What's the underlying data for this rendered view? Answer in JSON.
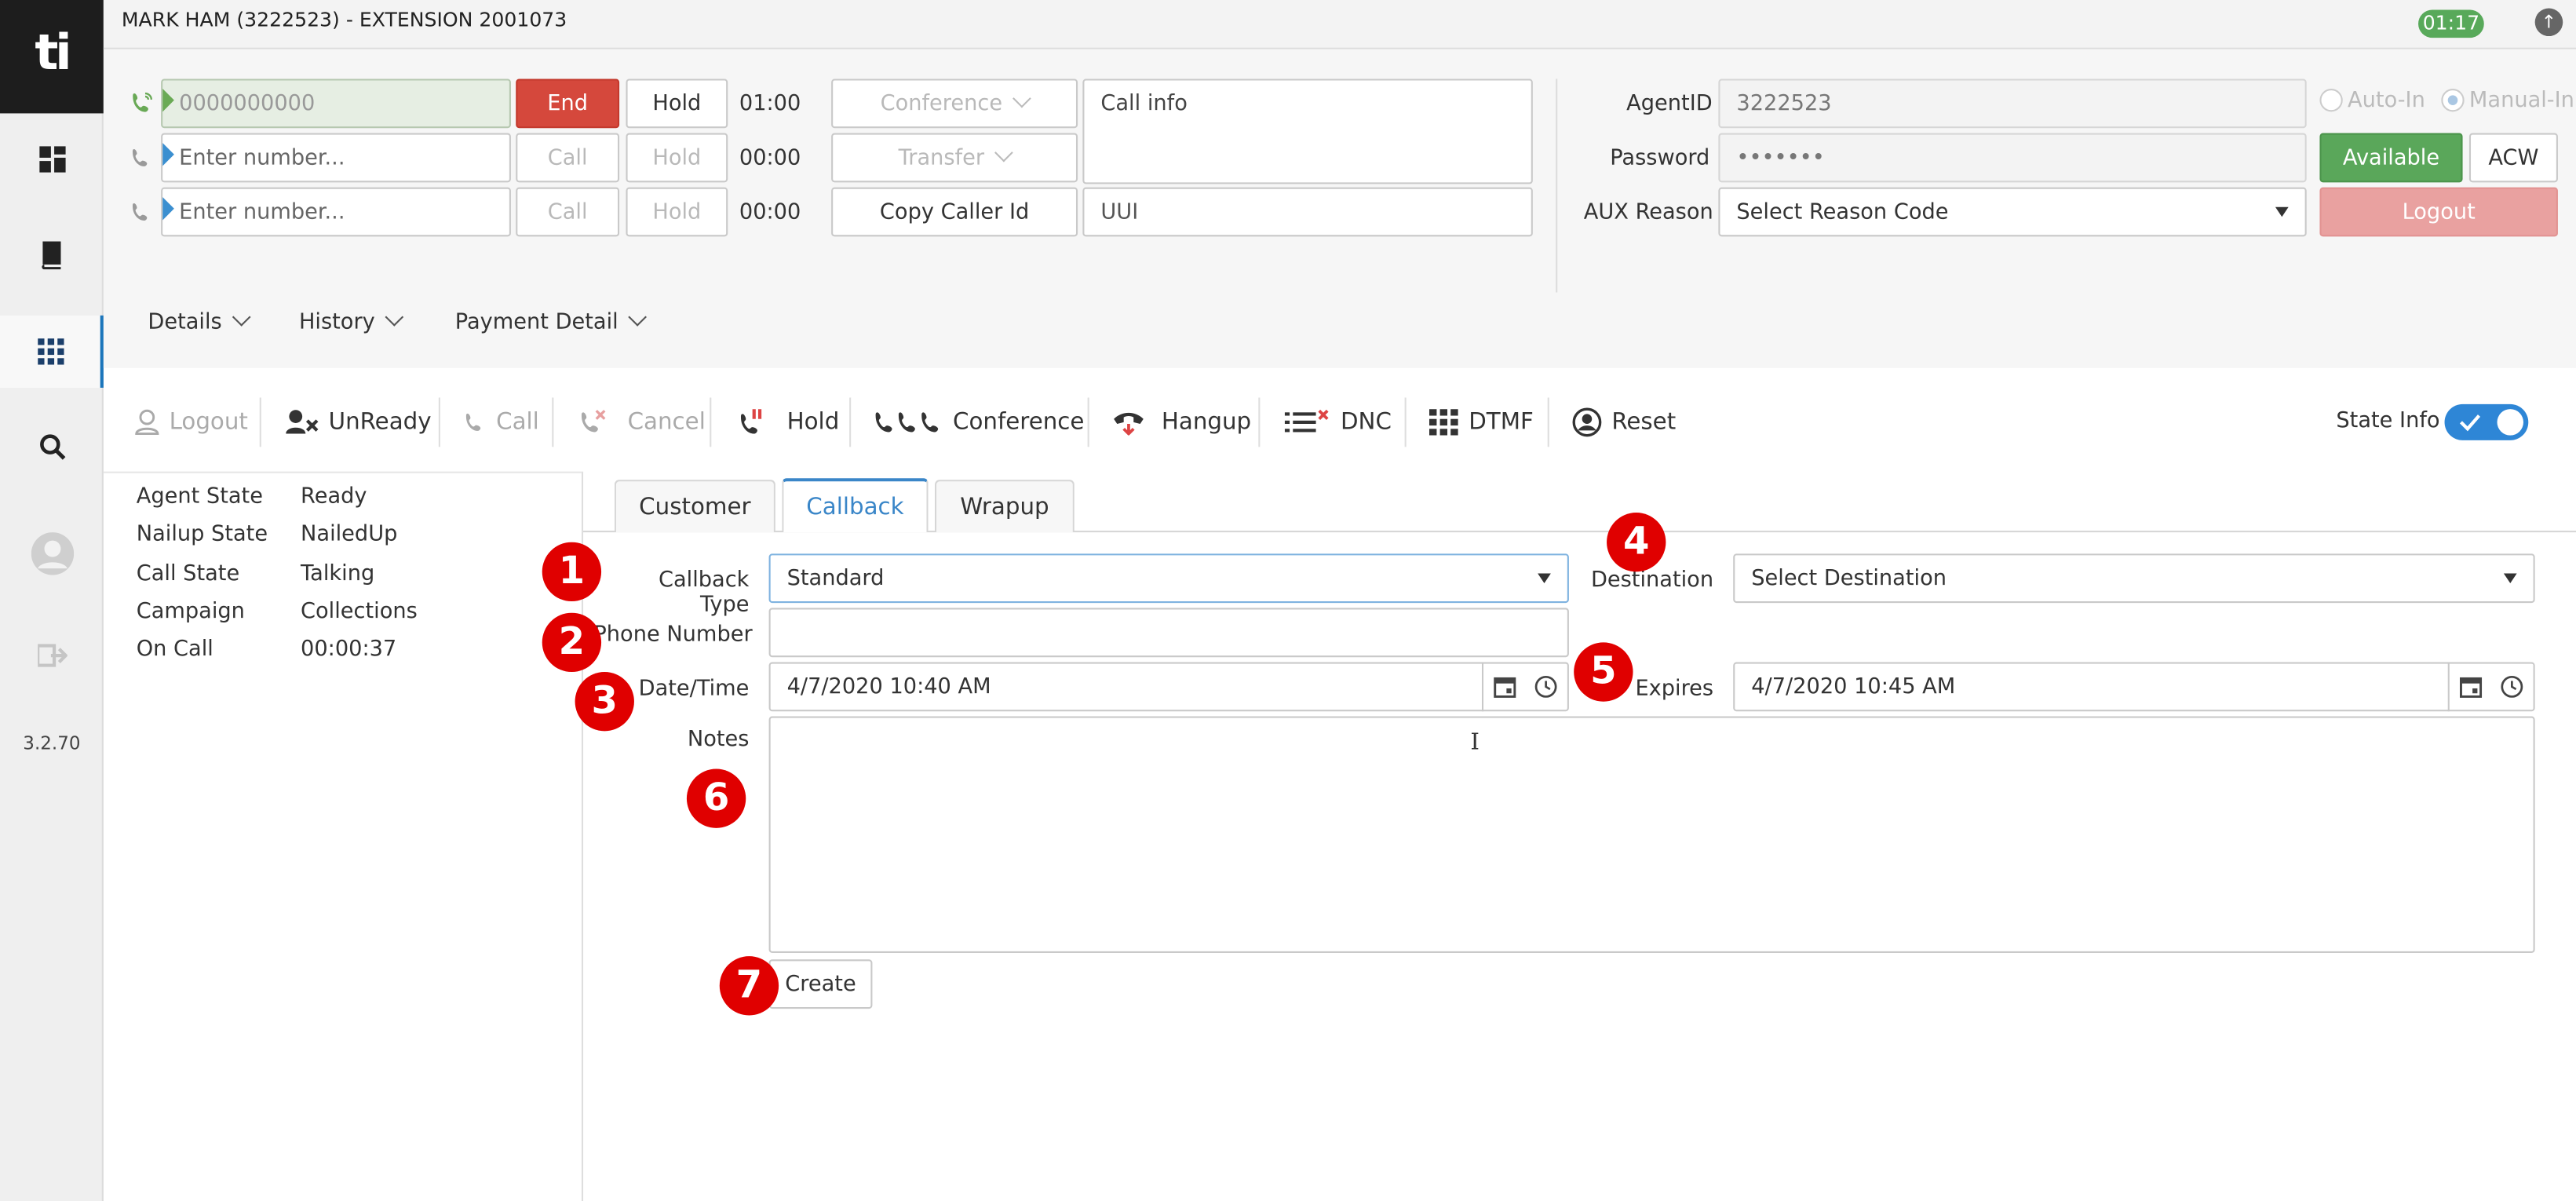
{
  "header": {
    "title": "MARK HAM (3222523) - EXTENSION 2001073",
    "timer": "01:17"
  },
  "sidebar": {
    "logo": "ti",
    "version": "3.2.70",
    "items": [
      {
        "icon": "dashboard-icon"
      },
      {
        "icon": "book-icon"
      },
      {
        "icon": "apps-grid-icon"
      },
      {
        "icon": "search-icon"
      },
      {
        "icon": "user-avatar-icon"
      },
      {
        "icon": "exit-icon"
      }
    ]
  },
  "lines": [
    {
      "placeholder": "0000000000",
      "call_label": "End",
      "hold_label": "Hold",
      "time": "01:00",
      "active": true
    },
    {
      "placeholder": "Enter number...",
      "call_label": "Call",
      "hold_label": "Hold",
      "time": "00:00",
      "active": false
    },
    {
      "placeholder": "Enter number...",
      "call_label": "Call",
      "hold_label": "Hold",
      "time": "00:00",
      "active": false
    }
  ],
  "call_actions": {
    "conference": "Conference",
    "transfer": "Transfer",
    "copy_caller_id": "Copy Caller Id",
    "call_info": "Call info",
    "uui": "UUI"
  },
  "agent": {
    "agent_id_label": "AgentID",
    "agent_id_value": "3222523",
    "password_label": "Password",
    "password_value": "•••••••",
    "aux_label": "AUX Reason",
    "aux_value": "Select Reason Code",
    "auto_in": "Auto-In",
    "manual_in": "Manual-In",
    "available": "Available",
    "acw": "ACW",
    "logout": "Logout"
  },
  "dropdown_menus": [
    "Details",
    "History",
    "Payment Detail"
  ],
  "toolbar": {
    "logout": "Logout",
    "unready": "UnReady",
    "call": "Call",
    "cancel": "Cancel",
    "hold": "Hold",
    "conference": "Conference",
    "hangup": "Hangup",
    "dnc": "DNC",
    "dtmf": "DTMF",
    "reset": "Reset",
    "state_info": "State Info"
  },
  "state_info": [
    {
      "label": "Agent State",
      "value": "Ready"
    },
    {
      "label": "Nailup State",
      "value": "NailedUp"
    },
    {
      "label": "Call State",
      "value": "Talking"
    },
    {
      "label": "Campaign",
      "value": "Collections"
    },
    {
      "label": "On Call",
      "value": "00:00:37"
    }
  ],
  "tabs": [
    "Customer",
    "Callback",
    "Wrapup"
  ],
  "callback_form": {
    "callback_type_label": "Callback Type",
    "callback_type_value": "Standard",
    "destination_label": "Destination",
    "destination_value": "Select Destination",
    "phone_label": "Phone Number",
    "phone_value": "",
    "datetime_label": "Date/Time",
    "datetime_value": "4/7/2020 10:40 AM",
    "expires_label": "Expires",
    "expires_value": "4/7/2020 10:45 AM",
    "notes_label": "Notes",
    "create_label": "Create"
  },
  "callouts": [
    "1",
    "2",
    "3",
    "4",
    "5",
    "6",
    "7"
  ],
  "colors": {
    "end_button": "#d5483c",
    "available_button": "#5aa75a",
    "logout_button": "#e9a1a0",
    "accent": "#3a86c8",
    "callout": "#e00000",
    "timer_badge": "#58a95a"
  }
}
